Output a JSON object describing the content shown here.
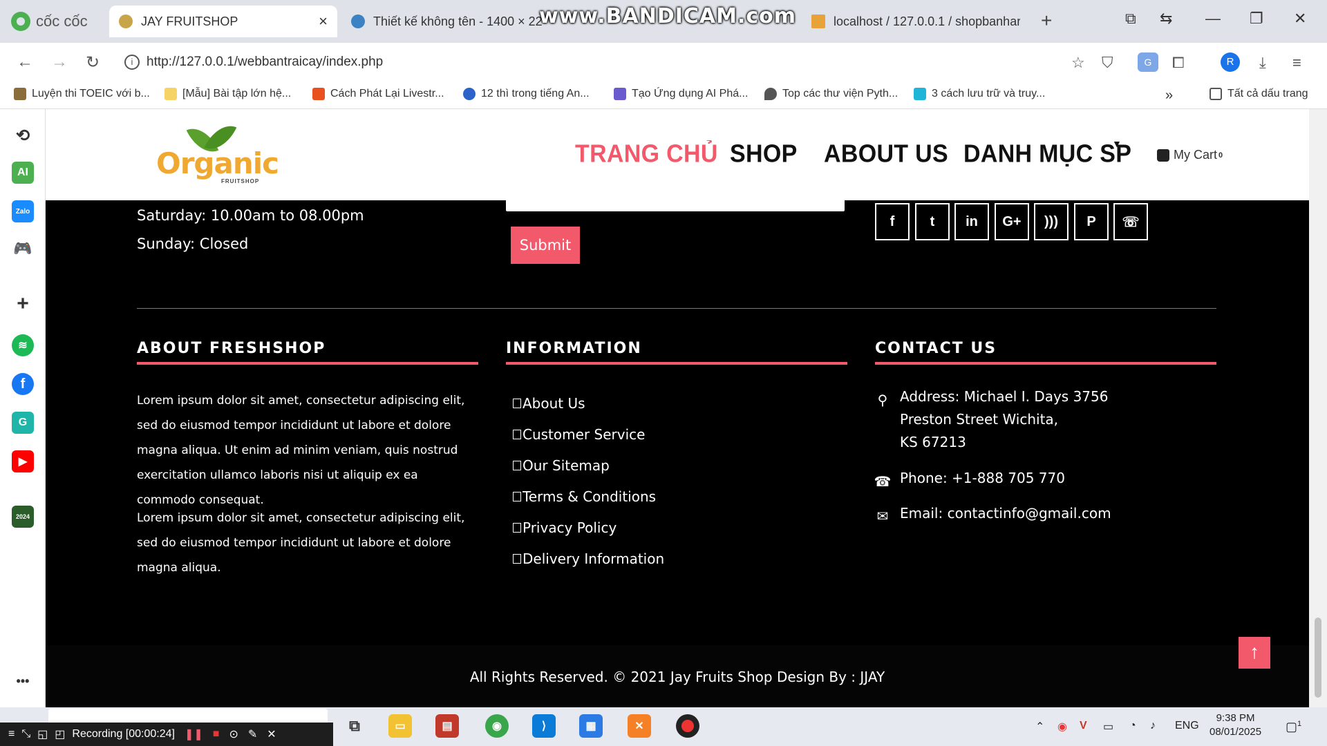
{
  "browser": {
    "brand": "cốc cốc",
    "tabs": [
      {
        "title": "JAY FRUITSHOP",
        "active": true
      },
      {
        "title": "Thiết kế không tên - 1400 × 22"
      },
      {
        "title": "localhost / 127.0.0.1 / shopbanhar"
      }
    ],
    "watermark": "www.BANDICAM.com",
    "url": "http://127.0.0.1/webbantraicay/index.php",
    "profile_initial": "R",
    "bookmarks": [
      "Luyện thi TOEIC với b...",
      "[Mẫu] Bài tập lớn hệ...",
      "Cách Phát Lại Livestr...",
      "12 thì trong tiếng An...",
      "Tạo Ứng dụng AI Phá...",
      "Top các thư viện Pyth...",
      "3 cách lưu trữ và truy...",
      "Tất cả dấu trang"
    ]
  },
  "sidebar": {
    "ai_label": "AI",
    "zalo_label": "Zalo",
    "g_label": "G",
    "year_label": "2024",
    "more": "•••"
  },
  "site": {
    "logo_text": "Organic",
    "logo_sub": "FRUITSHOP",
    "nav": [
      "TRANG CHỦ",
      "SHOP",
      "ABOUT US",
      "DANH MỤC SP"
    ],
    "cart_label": "My Cart",
    "cart_count": "0",
    "hours": [
      "Saturday: 10.00am to 08.00pm",
      "Sunday: Closed"
    ],
    "submit_label": "Submit",
    "social_icons": [
      "facebook-icon",
      "twitter-icon",
      "linkedin-icon",
      "google-plus-icon",
      "rss-icon",
      "pinterest-icon",
      "whatsapp-icon"
    ],
    "social_glyphs": [
      "f",
      "t",
      "in",
      "G+",
      ")))",
      "P",
      "☏"
    ],
    "about_title": "ABOUT FRESHSHOP",
    "about_para1": "Lorem ipsum dolor sit amet, consectetur adipiscing elit, sed do eiusmod tempor incididunt ut labore et dolore magna aliqua. Ut enim ad minim veniam, quis nostrud exercitation ullamco laboris nisi ut aliquip ex ea commodo consequat.",
    "about_para2": "Lorem ipsum dolor sit amet, consectetur adipiscing elit, sed do eiusmod tempor incididunt ut labore et dolore magna aliqua.",
    "info_title": "INFORMATION",
    "info_links": [
      "About Us",
      "Customer Service",
      "Our Sitemap",
      "Terms & Conditions",
      "Privacy Policy",
      "Delivery Information"
    ],
    "contact_title": "CONTACT US",
    "address_lines": [
      "Address: Michael I. Days 3756",
      "Preston Street Wichita,",
      "KS 67213"
    ],
    "phone": "Phone: +1-888 705 770",
    "email": "Email: contactinfo@gmail.com",
    "copyright": "All Rights Reserved. © 2021 Jay Fruits Shop Design By : JJAY",
    "accent": "#f25a6c"
  },
  "taskbar": {
    "recording": "Recording [00:00:24]",
    "lang": "ENG",
    "time": "9:38 PM",
    "date": "08/01/2025",
    "notif_count": "1"
  }
}
